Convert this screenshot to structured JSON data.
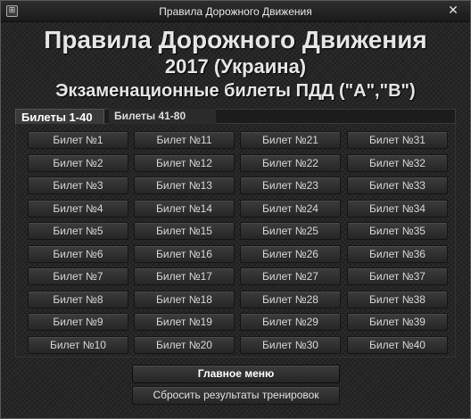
{
  "window": {
    "title": "Правила Дорожного Движения",
    "icon_text": "⊞",
    "close_glyph": "✕"
  },
  "header": {
    "title": "Правила Дорожного Движения",
    "subtitle": "2017 (Украина)",
    "caption": "Экзаменационные билеты ПДД (\"A\",\"B\")"
  },
  "tabs": [
    {
      "label": "Билеты 1-40",
      "active": true
    },
    {
      "label": "Билеты 41-80",
      "active": false
    }
  ],
  "tickets": [
    "Билет №1",
    "Билет №2",
    "Билет №3",
    "Билет №4",
    "Билет №5",
    "Билет №6",
    "Билет №7",
    "Билет №8",
    "Билет №9",
    "Билет №10",
    "Билет №11",
    "Билет №12",
    "Билет №13",
    "Билет №14",
    "Билет №15",
    "Билет №16",
    "Билет №17",
    "Билет №18",
    "Билет №19",
    "Билет №20",
    "Билет №21",
    "Билет №22",
    "Билет №23",
    "Билет №24",
    "Билет №25",
    "Билет №26",
    "Билет №27",
    "Билет №28",
    "Билет №29",
    "Билет №30",
    "Билет №31",
    "Билет №32",
    "Билет №33",
    "Билет №34",
    "Билет №35",
    "Билет №36",
    "Билет №37",
    "Билет №38",
    "Билет №39",
    "Билет №40"
  ],
  "buttons": {
    "main_menu": "Главное меню",
    "reset": "Сбросить результаты тренировок"
  }
}
